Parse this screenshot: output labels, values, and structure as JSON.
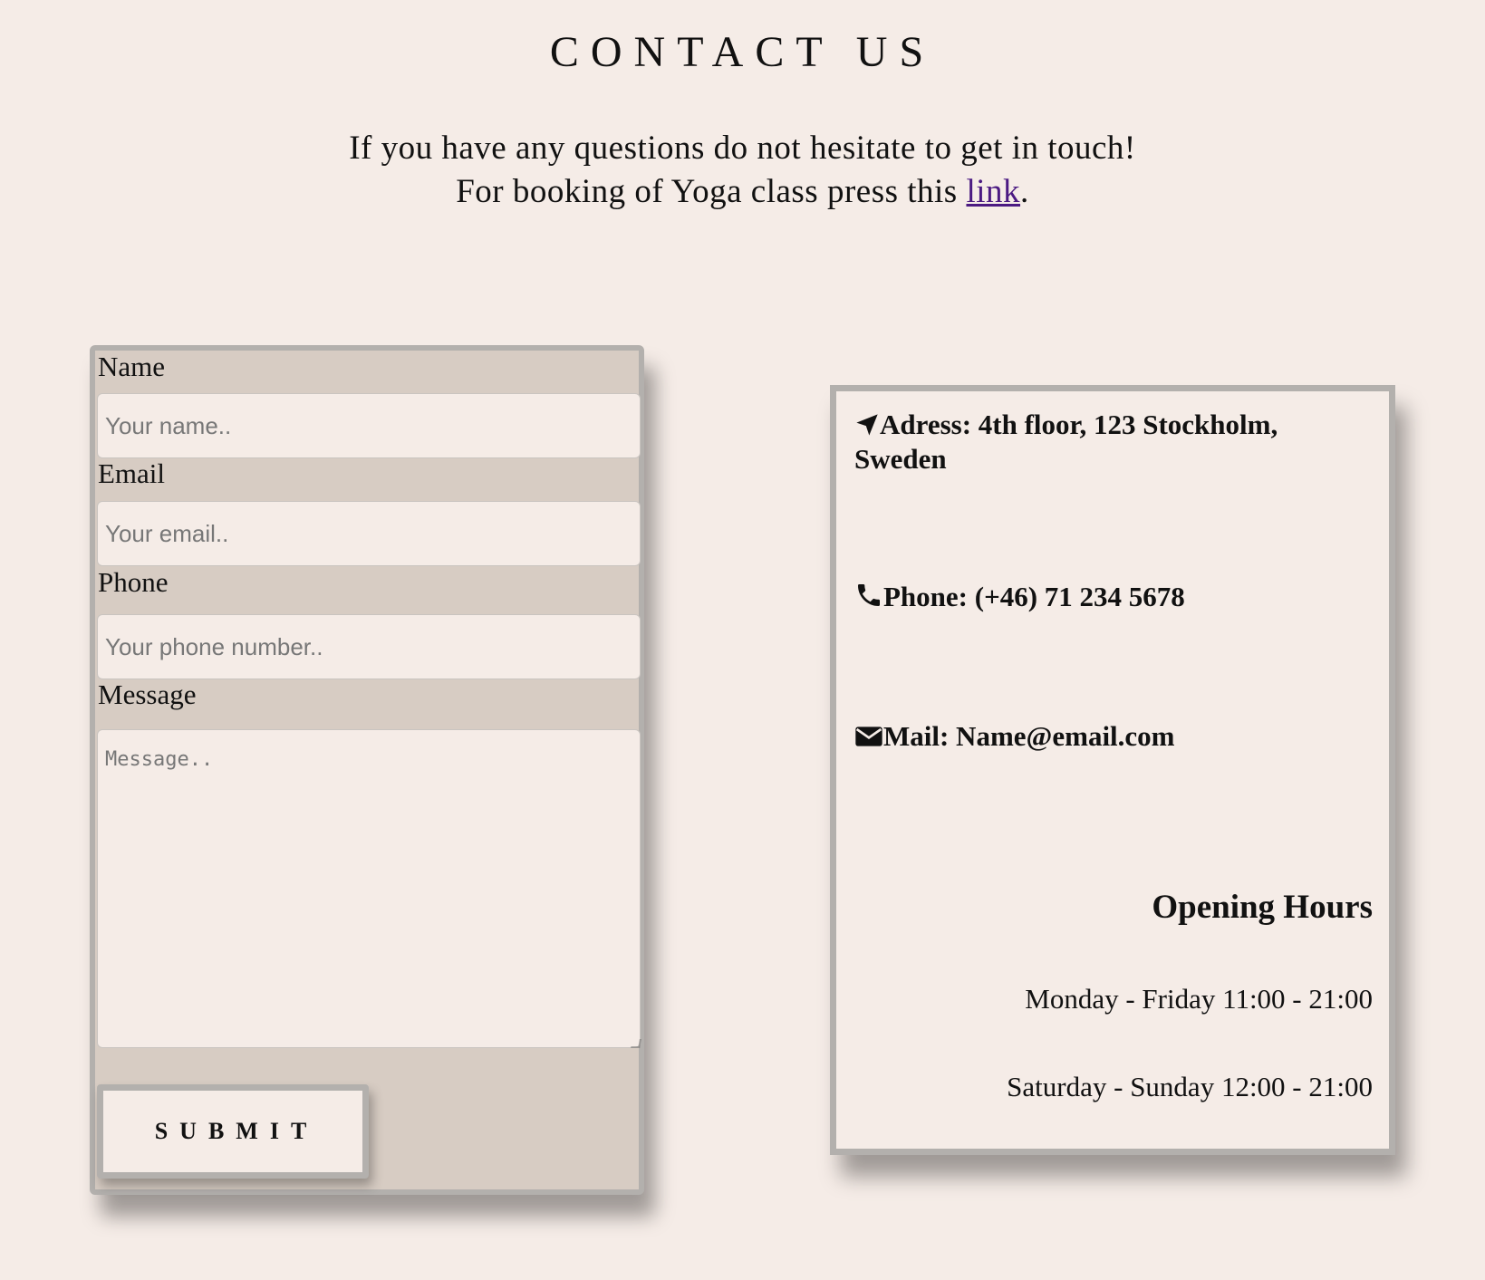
{
  "header": {
    "title": "CONTACT US",
    "intro_line1": "If you have any questions do not hesitate to get in touch!",
    "intro_line2_prefix": "For booking of Yoga class press this ",
    "intro_link": "link",
    "intro_line2_suffix": "."
  },
  "form": {
    "name_label": "Name",
    "name_placeholder": "Your name..",
    "email_label": "Email",
    "email_placeholder": "Your email..",
    "phone_label": "Phone",
    "phone_placeholder": "Your phone number..",
    "message_label": "Message",
    "message_placeholder": "Message..",
    "submit_label": "SUBMIT"
  },
  "info": {
    "address": "Adress: 4th floor, 123 Stockholm, Sweden",
    "address_icon": "location-arrow-icon",
    "phone": "Phone: (+46) 71 234 5678",
    "phone_icon": "phone-icon",
    "mail": "Mail: Name@email.com",
    "mail_icon": "envelope-icon",
    "hours_title": "Opening Hours",
    "hours": [
      "Monday - Friday 11:00 - 21:00",
      "Saturday - Sunday 12:00 - 21:00"
    ]
  },
  "colors": {
    "background": "#f5ece7",
    "form_background": "#d7ccc3",
    "border": "#b3b0ad",
    "link": "#4b1a82"
  }
}
